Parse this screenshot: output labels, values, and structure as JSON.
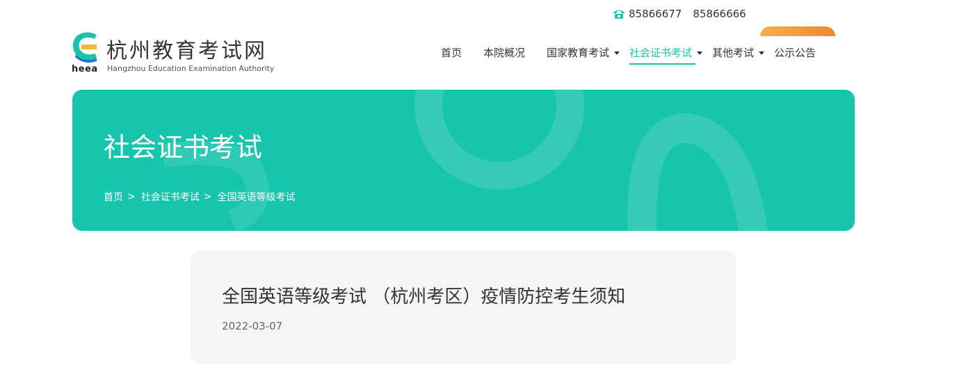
{
  "topbar": {
    "icon": "phone-icon",
    "phones": [
      "85866677",
      "85866666"
    ]
  },
  "logo": {
    "icon": "heea-logo-icon",
    "abbr": "heea",
    "name_cn": "杭州教育考试网",
    "name_en": "Hangzhou Education Examination Authority"
  },
  "nav": {
    "items": [
      {
        "label": "首页",
        "dropdown": false,
        "active": false
      },
      {
        "label": "本院概况",
        "dropdown": false,
        "active": false
      },
      {
        "label": "国家教育考试",
        "dropdown": true,
        "active": false
      },
      {
        "label": "社会证书考试",
        "dropdown": true,
        "active": true
      },
      {
        "label": "其他考试",
        "dropdown": true,
        "active": false
      },
      {
        "label": "公示公告",
        "dropdown": false,
        "active": false
      }
    ]
  },
  "banner": {
    "title": "社会证书考试",
    "breadcrumb": [
      "首页",
      "社会证书考试",
      "全国英语等级考试"
    ],
    "separator": ">"
  },
  "article": {
    "title": "全国英语等级考试 （杭州考区）疫情防控考生须知",
    "date": "2022-03-07"
  },
  "colors": {
    "accent": "#17c4ac",
    "orange": "#f0942f",
    "logo_blue": "#1e78c8",
    "logo_yellow": "#f5b82e",
    "logo_teal": "#19c2a9"
  }
}
